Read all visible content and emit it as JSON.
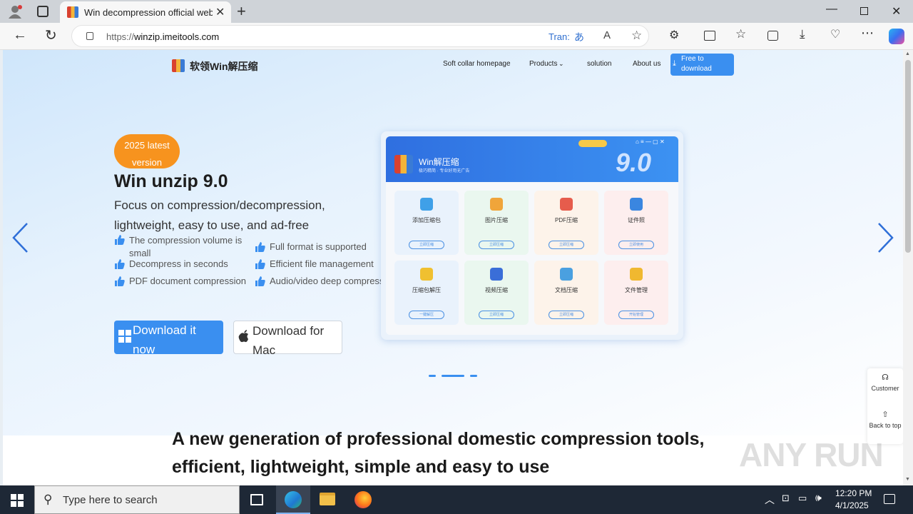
{
  "browser": {
    "tab_title": "Win decompression official web",
    "url_prefix": "https://",
    "url_domain": "winzip.imeitools.com",
    "translate_label": "Tran:"
  },
  "site": {
    "logo_text": "软领Win解压缩",
    "nav": [
      "Soft collar homepage",
      "Products",
      "solution",
      "About us"
    ],
    "nav_download": "Free to download"
  },
  "hero": {
    "badge": "2025 latest version",
    "title": "Win unzip 9.0",
    "subtitle": "Focus on compression/decompression, lightweight, easy to use, and ad-free",
    "features": [
      "The compression volume is small",
      "Full format is supported",
      "Decompress in seconds",
      "Efficient file management",
      "PDF document compression",
      "Audio/video deep compression"
    ],
    "download_windows": "Download it now",
    "download_mac": "Download for Mac"
  },
  "app_preview": {
    "app_name": "Win解压缩",
    "app_tagline": "极巧精简 · 专业好用无广告",
    "version_mark": "9.0",
    "cards": [
      {
        "title": "添加压缩包",
        "button": "立即压缩",
        "color": "#e9f2fc",
        "icon": "#3fa0e8"
      },
      {
        "title": "图片压缩",
        "button": "立即压缩",
        "color": "#eaf7ef",
        "icon": "#f0a53a"
      },
      {
        "title": "PDF压缩",
        "button": "立即压缩",
        "color": "#fdf3ea",
        "icon": "#e65c4c"
      },
      {
        "title": "证件照",
        "button": "立即使用",
        "color": "#fdeeee",
        "icon": "#3a86e0"
      },
      {
        "title": "压缩包解压",
        "button": "一键解压",
        "color": "#e9f2fc",
        "icon": "#f0c030"
      },
      {
        "title": "视频压缩",
        "button": "立即压缩",
        "color": "#eaf7ef",
        "icon": "#3a6ed8"
      },
      {
        "title": "文档压缩",
        "button": "立即压缩",
        "color": "#fdf3ea",
        "icon": "#4aa0e0"
      },
      {
        "title": "文件管理",
        "button": "开始管理",
        "color": "#fdeeee",
        "icon": "#f0b830"
      }
    ]
  },
  "side_tools": {
    "customer": "Customer",
    "back_to_top": "Back to top"
  },
  "section_heading": "A new generation of professional domestic compression tools, efficient, lightweight, simple and easy to use",
  "watermark": "ANY RUN",
  "taskbar": {
    "search_placeholder": "Type here to search",
    "time": "12:20 PM",
    "date": "4/1/2025"
  },
  "colors": {
    "accent": "#3a8ff0",
    "badge": "#f7931e"
  }
}
